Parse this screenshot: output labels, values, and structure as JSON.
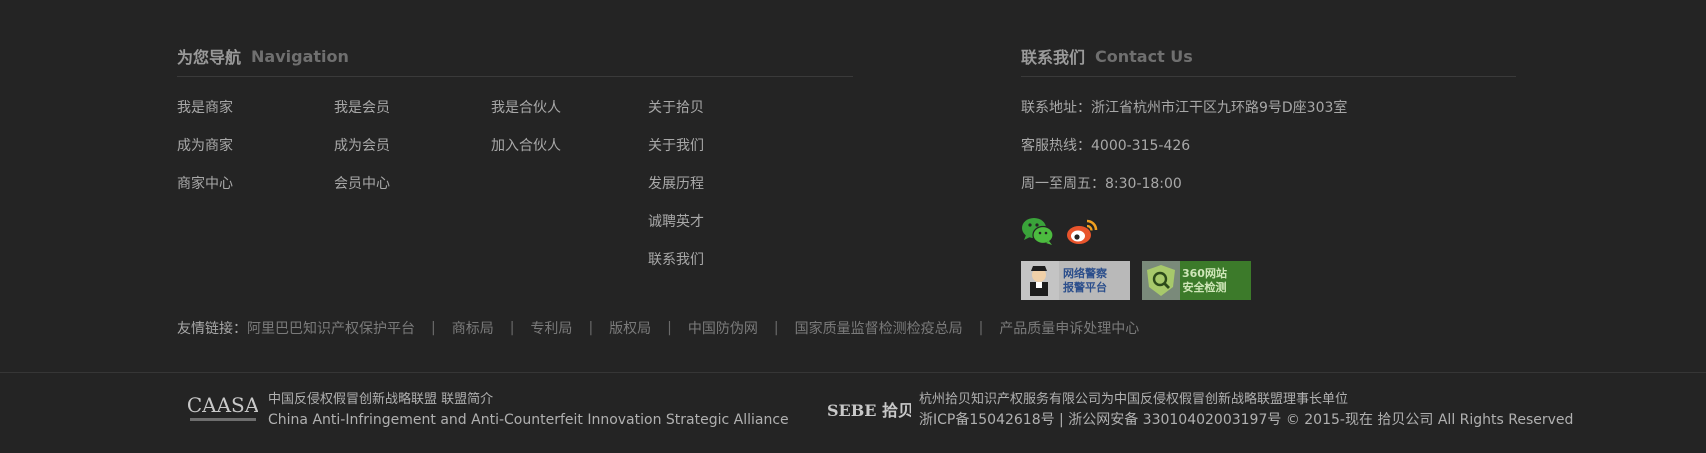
{
  "navigation": {
    "title_cn": "为您导航",
    "title_en": "Navigation",
    "columns": [
      [
        "我是商家",
        "成为商家",
        "商家中心"
      ],
      [
        "我是会员",
        "成为会员",
        "会员中心"
      ],
      [
        "我是合伙人",
        "加入合伙人"
      ],
      [
        "关于拾贝",
        "关于我们",
        "发展历程",
        "诚聘英才",
        "联系我们"
      ]
    ]
  },
  "contact": {
    "title_cn": "联系我们",
    "title_en": "Contact Us",
    "address": "联系地址：浙江省杭州市江干区九环路9号D座303室",
    "hotline": "客服热线：4000-315-426",
    "hours": "周一至周五：8:30-18:00",
    "social_icons": [
      "wechat-icon",
      "weibo-icon"
    ],
    "badges": {
      "police": "网络警察\n报警平台",
      "safe360": "360网站\n安全检测"
    }
  },
  "friend_links": {
    "label": "友情链接：",
    "links": [
      "阿里巴巴知识产权保护平台",
      "商标局",
      "专利局",
      "版权局",
      "中国防伪网",
      "国家质量监督检测检疫总局",
      "产品质量申诉处理中心"
    ],
    "separator": "|"
  },
  "bottom": {
    "left_logo": "CAASA",
    "left_line1": "中国反侵权假冒创新战略联盟 联盟简介",
    "left_line2": "China Anti-Infringement and Anti-Counterfeit Innovation Strategic Alliance",
    "right_logo": "SEBE 拾贝",
    "right_line1": "杭州拾贝知识产权服务有限公司为中国反侵权假冒创新战略联盟理事长单位",
    "right_line2": "浙ICP备15042618号 | 浙公网安备 33010402003197号 © 2015-现在 拾贝公司 All Rights Reserved"
  },
  "colors": {
    "background": "#242424",
    "wechat": "#3aa33a",
    "weibo": "#e8542c",
    "badge_green": "#3c7a2a"
  }
}
